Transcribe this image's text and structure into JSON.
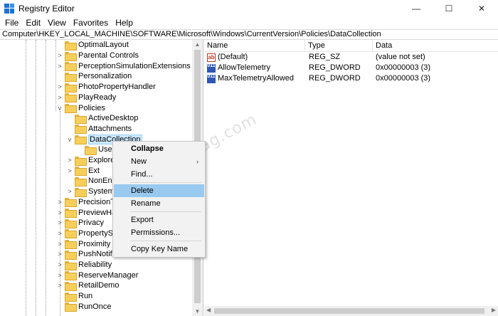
{
  "window": {
    "title": "Registry Editor",
    "controls": {
      "minimize": "—",
      "maximize": "☐",
      "close": "✕"
    }
  },
  "menu": [
    "File",
    "Edit",
    "View",
    "Favorites",
    "Help"
  ],
  "address": "Computer\\HKEY_LOCAL_MACHINE\\SOFTWARE\\Microsoft\\Windows\\CurrentVersion\\Policies\\DataCollection",
  "tree": {
    "items": [
      {
        "label": "OptimalLayout",
        "expander": ""
      },
      {
        "label": "Parental Controls",
        "expander": ">"
      },
      {
        "label": "PerceptionSimulationExtensions",
        "expander": ">"
      },
      {
        "label": "Personalization",
        "expander": ""
      },
      {
        "label": "PhotoPropertyHandler",
        "expander": ">"
      },
      {
        "label": "PlayReady",
        "expander": ">"
      },
      {
        "label": "Policies",
        "expander": "v"
      },
      {
        "label": "ActiveDesktop",
        "expander": ""
      },
      {
        "label": "Attachments",
        "expander": ""
      },
      {
        "label": "DataCollection",
        "expander": "v"
      },
      {
        "label": "Users",
        "expander": ""
      },
      {
        "label": "Explorer",
        "expander": ">"
      },
      {
        "label": "Ext",
        "expander": ">"
      },
      {
        "label": "NonEnum",
        "expander": ""
      },
      {
        "label": "System",
        "expander": ">"
      },
      {
        "label": "PrecisionTou",
        "expander": ">"
      },
      {
        "label": "PreviewHand",
        "expander": ">"
      },
      {
        "label": "Privacy",
        "expander": ">"
      },
      {
        "label": "PropertySyst",
        "expander": ">"
      },
      {
        "label": "Proximity",
        "expander": ">"
      },
      {
        "label": "PushNotifica",
        "expander": ">"
      },
      {
        "label": "Reliability",
        "expander": ">"
      },
      {
        "label": "ReserveManager",
        "expander": ">"
      },
      {
        "label": "RetailDemo",
        "expander": ">"
      },
      {
        "label": "Run",
        "expander": ""
      },
      {
        "label": "RunOnce",
        "expander": ""
      }
    ]
  },
  "values": {
    "headers": {
      "name": "Name",
      "type": "Type",
      "data": "Data"
    },
    "rows": [
      {
        "name": "(Default)",
        "type": "REG_SZ",
        "data": "(value not set)",
        "icon": "ab"
      },
      {
        "name": "AllowTelemetry",
        "type": "REG_DWORD",
        "data": "0x00000003 (3)",
        "icon": "011"
      },
      {
        "name": "MaxTelemetryAllowed",
        "type": "REG_DWORD",
        "data": "0x00000003 (3)",
        "icon": "011"
      }
    ]
  },
  "context_menu": {
    "items": [
      "Collapse",
      "New",
      "Find...",
      "Delete",
      "Rename",
      "Export",
      "Permissions...",
      "Copy Key Name"
    ],
    "submenu_arrow": "›"
  },
  "watermark": "geekermag.com",
  "colors": {
    "selection": "#cce8ff",
    "menu_highlight": "#99c9ef",
    "folder": "#f6cf5b"
  }
}
